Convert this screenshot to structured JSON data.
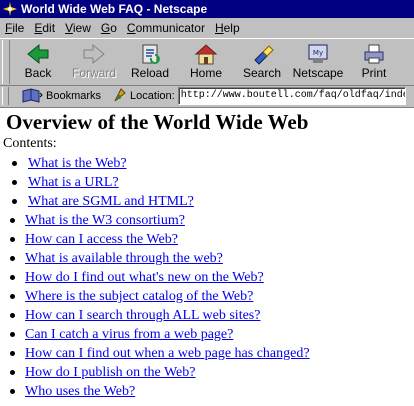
{
  "window": {
    "title": "World Wide Web FAQ - Netscape"
  },
  "menu": [
    {
      "label_u": "F",
      "label_rest": "ile"
    },
    {
      "label_u": "E",
      "label_rest": "dit"
    },
    {
      "label_u": "V",
      "label_rest": "iew"
    },
    {
      "label_u": "G",
      "label_rest": "o"
    },
    {
      "label_u": "C",
      "label_rest": "ommunicator"
    },
    {
      "label_u": "H",
      "label_rest": "elp"
    }
  ],
  "toolbar": {
    "back": "Back",
    "forward": "Forward",
    "reload": "Reload",
    "home": "Home",
    "search": "Search",
    "netscape": "Netscape",
    "print": "Print"
  },
  "location_bar": {
    "bookmarks": "Bookmarks",
    "location_label": "Location:",
    "url": "http://www.boutell.com/faq/oldfaq/index.html"
  },
  "page": {
    "title": "Overview of the World Wide Web",
    "contents_label": "Contents:",
    "list1": [
      "What is the Web?",
      "What is a URL?",
      "What are SGML and HTML?"
    ],
    "list2": [
      "What is the W3 consortium?",
      "How can I access the Web?",
      "What is available through the web?",
      "How do I find out what's new on the Web?",
      "Where is the subject catalog of the Web?",
      "How can I search through ALL web sites?",
      "Can I catch a virus from a web page?",
      "How can I find out when a web page has changed?",
      "How do I publish on the Web?",
      "Who uses the Web?"
    ]
  },
  "colors": {
    "title_bar": "#000080",
    "link": "#0000ee",
    "chrome": "#c0c0c0"
  }
}
